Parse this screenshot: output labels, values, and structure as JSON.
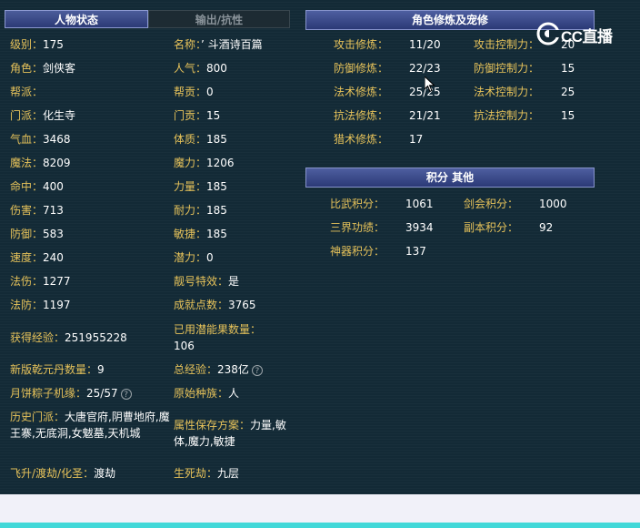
{
  "tabs": [
    {
      "label": "人物状态",
      "active": true
    },
    {
      "label": "输出/抗性",
      "active": false
    }
  ],
  "sections": {
    "cultivation_title": "角色修炼及宠修",
    "points_title": "积分 其他"
  },
  "character": {
    "left": [
      {
        "label": "级别",
        "value": "175"
      },
      {
        "label": "角色",
        "value": "剑侠客"
      },
      {
        "label": "帮派",
        "value": ""
      },
      {
        "label": "门派",
        "value": "化生寺"
      },
      {
        "label": "气血",
        "value": "3468"
      },
      {
        "label": "魔法",
        "value": "8209"
      },
      {
        "label": "命中",
        "value": "400"
      },
      {
        "label": "伤害",
        "value": "713"
      },
      {
        "label": "防御",
        "value": "583"
      },
      {
        "label": "速度",
        "value": "240"
      },
      {
        "label": "法伤",
        "value": "1277"
      },
      {
        "label": "法防",
        "value": "1197"
      }
    ],
    "right": [
      {
        "label": "名称",
        "value": "’ 斗酒诗百篇"
      },
      {
        "label": "人气",
        "value": "800"
      },
      {
        "label": "帮贡",
        "value": "0"
      },
      {
        "label": "门贡",
        "value": "15"
      },
      {
        "label": "体质",
        "value": "185"
      },
      {
        "label": "魔力",
        "value": "1206"
      },
      {
        "label": "力量",
        "value": "185"
      },
      {
        "label": "耐力",
        "value": "185"
      },
      {
        "label": "敏捷",
        "value": "185"
      },
      {
        "label": "潜力",
        "value": "0"
      },
      {
        "label": "靓号特效",
        "value": "是"
      },
      {
        "label": "成就点数",
        "value": "3765"
      }
    ],
    "exp_label": "获得经验",
    "exp_value": "251955228",
    "potential_fruit_label": "已用潜能果数量",
    "potential_fruit_value": "106",
    "qianyuan_label": "新版乾元丹数量",
    "qianyuan_value": "9",
    "total_exp_label": "总经验",
    "total_exp_value": "238亿",
    "mooncake_label": "月饼粽子机缘",
    "mooncake_value": "25/57",
    "origin_race_label": "原始种族",
    "origin_race_value": "人",
    "history_school_label": "历史门派",
    "history_school_value": "大唐官府,阴曹地府,魔王寨,无底洞,女魃墓,天机城",
    "attr_plan_label": "属性保存方案",
    "attr_plan_value": "力量,敏体,魔力,敏捷",
    "ascension_label": "飞升/渡劫/化圣",
    "ascension_value": "渡劫",
    "life_death_label": "生死劫",
    "life_death_value": "九层"
  },
  "cultivation": [
    {
      "label": "攻击修炼",
      "value": "11/20",
      "ctrl_label": "攻击控制力",
      "ctrl_value": "20"
    },
    {
      "label": "防御修炼",
      "value": "22/23",
      "ctrl_label": "防御控制力",
      "ctrl_value": "15"
    },
    {
      "label": "法术修炼",
      "value": "25/25",
      "ctrl_label": "法术控制力",
      "ctrl_value": "25"
    },
    {
      "label": "抗法修炼",
      "value": "21/21",
      "ctrl_label": "抗法控制力",
      "ctrl_value": "15"
    },
    {
      "label": "猎术修炼",
      "value": "17",
      "ctrl_label": "",
      "ctrl_value": ""
    }
  ],
  "points": [
    {
      "label": "比武积分",
      "value": "1061",
      "label2": "剑会积分",
      "value2": "1000"
    },
    {
      "label": "三界功绩",
      "value": "3934",
      "label2": "副本积分",
      "value2": "92"
    },
    {
      "label": "神器积分",
      "value": "137",
      "label2": "",
      "value2": ""
    }
  ],
  "watermark": {
    "text": "CC直播",
    "icon": "cc-live-logo-icon"
  },
  "colors": {
    "label": "#e6c25a",
    "value": "#ffffff",
    "background": "#132a36",
    "header": "#34427f"
  }
}
